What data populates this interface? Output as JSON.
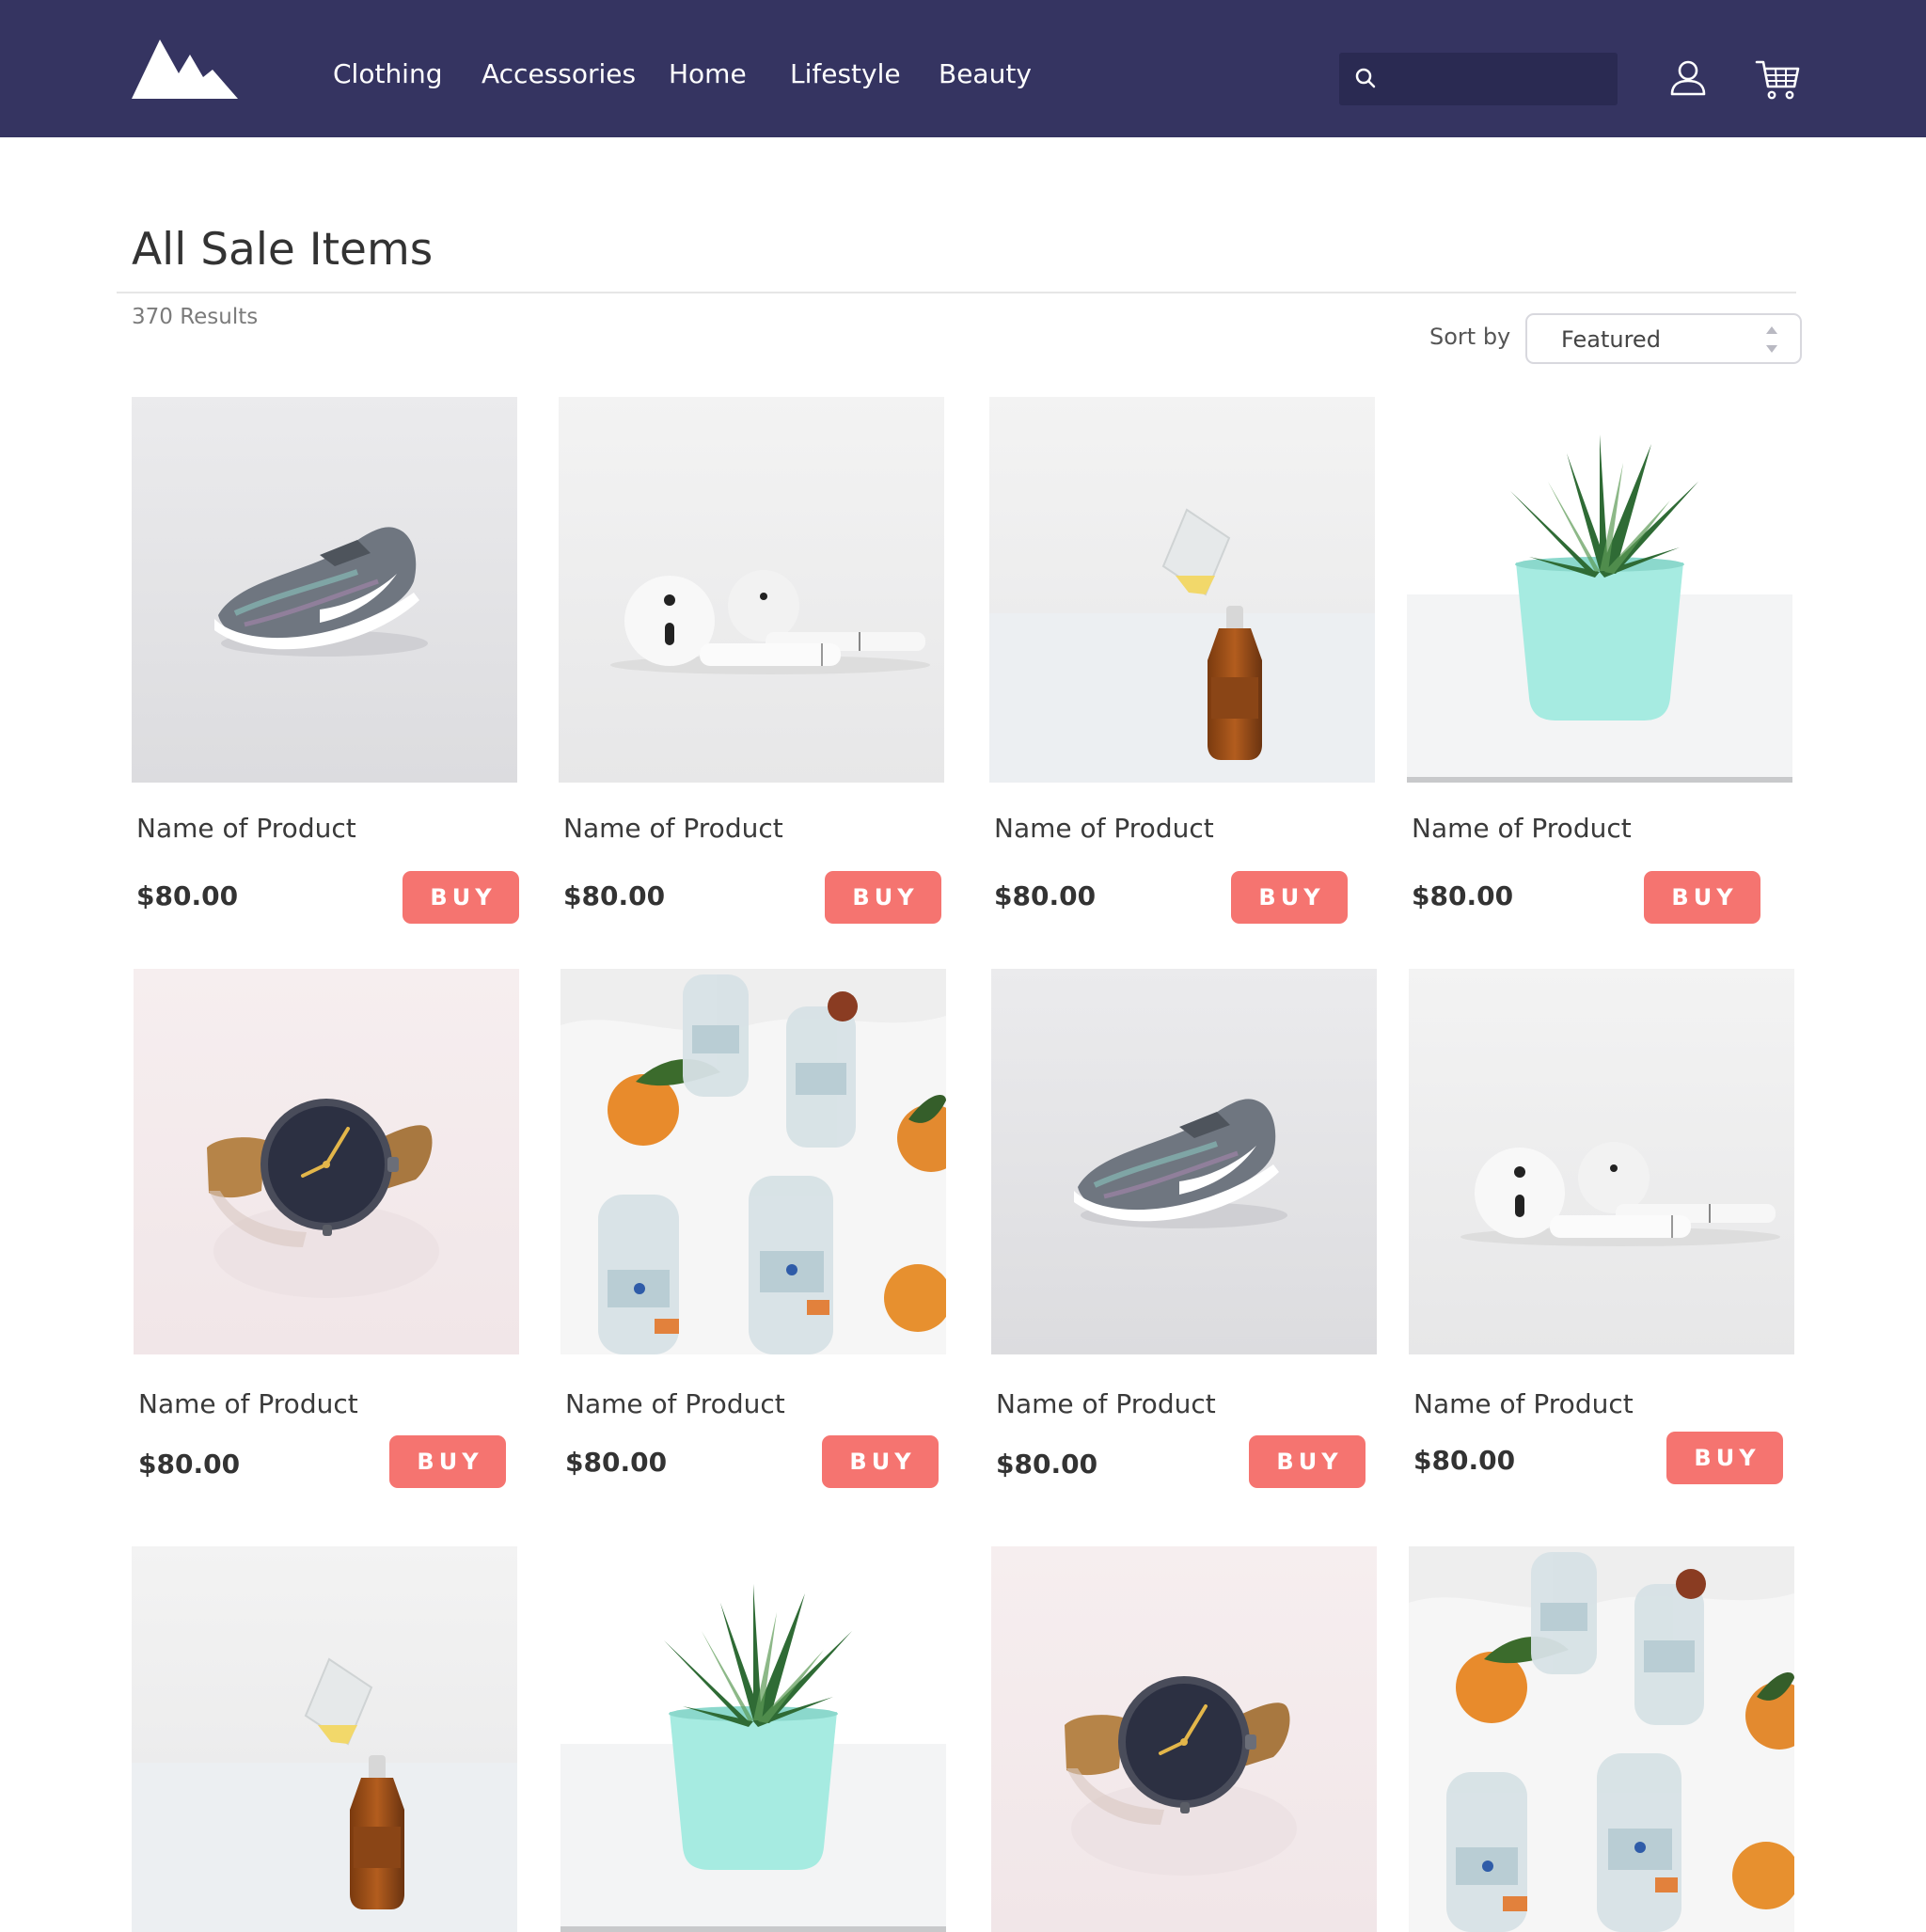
{
  "nav": {
    "items": [
      "Clothing",
      "Accessories",
      "Home",
      "Lifestyle",
      "Beauty"
    ]
  },
  "search": {
    "placeholder": "",
    "value": ""
  },
  "page": {
    "title": "All Sale Items",
    "results": "370 Results",
    "sort_label": "Sort by",
    "sort_value": "Featured"
  },
  "colors": {
    "header_bg": "#353461",
    "buy_button": "#f57470",
    "accent_text": "#ffffff"
  },
  "products": [
    {
      "name": "Name of Product",
      "price": "$80.00",
      "buy": "BUY",
      "image": "sneaker"
    },
    {
      "name": "Name of Product",
      "price": "$80.00",
      "buy": "BUY",
      "image": "earbuds"
    },
    {
      "name": "Name of Product",
      "price": "$80.00",
      "buy": "BUY",
      "image": "bottle"
    },
    {
      "name": "Name of Product",
      "price": "$80.00",
      "buy": "BUY",
      "image": "plant"
    },
    {
      "name": "Name of Product",
      "price": "$80.00",
      "buy": "BUY",
      "image": "watch"
    },
    {
      "name": "Name of Product",
      "price": "$80.00",
      "buy": "BUY",
      "image": "water-bottles"
    },
    {
      "name": "Name of Product",
      "price": "$80.00",
      "buy": "BUY",
      "image": "sneaker"
    },
    {
      "name": "Name of Product",
      "price": "$80.00",
      "buy": "BUY",
      "image": "earbuds"
    },
    {
      "image": "bottle"
    },
    {
      "image": "plant"
    },
    {
      "image": "watch"
    },
    {
      "image": "water-bottles"
    }
  ]
}
